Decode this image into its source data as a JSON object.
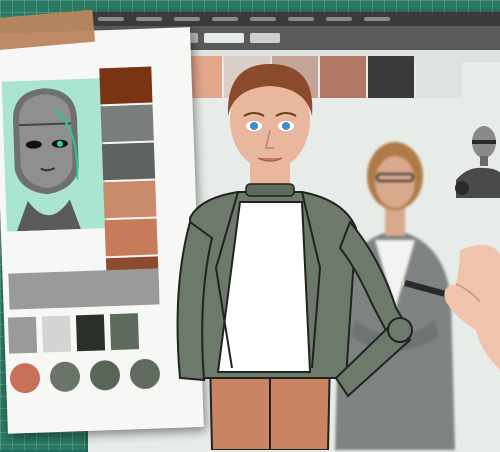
{
  "scene": {
    "mat_color": "#2a7a63",
    "window_bg": "#e8ece8"
  },
  "app_window": {
    "menu_items": 8,
    "toolbar_tab_colors": [
      "#e8ece8",
      "#cfcfcf",
      "#b7b7b7",
      "#e8ece8",
      "#cfcfcf"
    ]
  },
  "palette": {
    "top_row": [
      "#4a2a20",
      "#c9846c",
      "#e2a68a",
      "#d9cfc6",
      "#c4a496",
      "#b07862",
      "#3a3a3a",
      "#dfe3df"
    ],
    "left_column": [
      "#b58a76",
      "#7e5a4c",
      "#c7a08d",
      "#d2b3a3",
      "#e6d5cc"
    ]
  },
  "reference_card": {
    "tape_color": "#b9865e",
    "robot_bg": "#a9e5cf",
    "swatch_column": [
      "#7b3413",
      "#7a7e7b",
      "#5e635f",
      "#c98b6c",
      "#c77b5a",
      "#8e4a2c"
    ],
    "bar_color": "#9a9a9a",
    "squares": [
      "#9a9b99",
      "#d4d5d3",
      "#283028",
      "#5f6a5f"
    ],
    "circles": [
      "#c77258",
      "#6a7468",
      "#5a6459",
      "#616b60"
    ]
  },
  "figure": {
    "skin": "#e9b79e",
    "hair": "#8c4a2c",
    "jacket": "#6d7a6b",
    "shirt": "#ffffff",
    "pants": "#c98563",
    "eye": "#3a8fc8"
  },
  "background_person": {
    "hair": "#b07a48",
    "blazer": "#7f8483",
    "skin": "#d8a98c"
  },
  "pencil": {
    "body": "#2a2a2a",
    "tip": "#e2c8a4"
  }
}
